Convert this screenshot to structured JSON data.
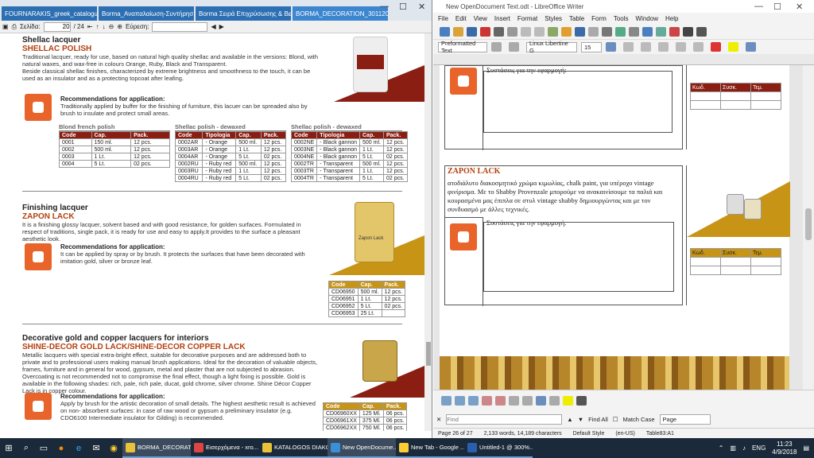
{
  "browser": {
    "tabs": [
      {
        "label": "FOURNARAKIS_greek_catalogue..."
      },
      {
        "label": "Borma_Αναπαλαίωση-Συντήρησ..."
      },
      {
        "label": "Borma Σειρά Επιχρύσωσης & Βε..."
      },
      {
        "label": "BORMA_DECORATION_3011201..."
      }
    ],
    "page_label": "Σελίδα:",
    "page_value": "20",
    "page_total": "/ 24",
    "search_label": "Εύρεση:"
  },
  "pdf": {
    "shellac": {
      "title": "Shellac lacquer",
      "subtitle": "SHELLAC POLISH",
      "desc1": "Traditional lacquer, ready for use, based on natural high quality shellac and available in the versions: Blond, with natural waxes, and wax-free in colours Orange, Ruby, Black and Transparent.",
      "desc2": "Beside classical shellac finishes, characterized by extreme brightness and smoothness to the touch, it can be used as an insulator and as a protecting topcoat after leafing.",
      "rec_title": "Recommendations for application:",
      "rec_text": "Traditionally applied by buffer for the finishing of furniture, this lacuer can be spreaded also by brush to insulate and protect small areas.",
      "t1": {
        "caption": "Blond french polish",
        "headers": [
          "Code",
          "Cap.",
          "Pack."
        ],
        "rows": [
          [
            "0001",
            "150 ml.",
            "12 pcs."
          ],
          [
            "0002",
            "500 ml.",
            "12 pcs."
          ],
          [
            "0003",
            "1 Lt.",
            "12 pcs."
          ],
          [
            "0004",
            "5 Lt.",
            "02 pcs."
          ]
        ]
      },
      "t2": {
        "caption": "Shellac polish - dewaxed",
        "headers": [
          "Code",
          "Tipologia",
          "Cap.",
          "Pack."
        ],
        "rows": [
          [
            "0002AR",
            "- Orange",
            "500 ml.",
            "12 pcs."
          ],
          [
            "0003AR",
            "- Orange",
            "1 Lt.",
            "12 pcs."
          ],
          [
            "0004AR",
            "- Orange",
            "5 Lt.",
            "02 pcs."
          ],
          [
            "0002RU",
            "- Ruby red",
            "500 ml.",
            "12 pcs."
          ],
          [
            "0003RU",
            "- Ruby red",
            "1 Lt.",
            "12 pcs."
          ],
          [
            "0004RU",
            "- Ruby red",
            "5 Lt.",
            "02 pcs."
          ]
        ]
      },
      "t3": {
        "caption": "Shellac polish - dewaxed",
        "headers": [
          "Code",
          "Tipologia",
          "Cap.",
          "Pack."
        ],
        "rows": [
          [
            "0002NE",
            "- Black gannon",
            "500 ml.",
            "12 pcs."
          ],
          [
            "0003NE",
            "- Black gannon",
            "1 Lt.",
            "12 pcs."
          ],
          [
            "0004NE",
            "- Black gannon",
            "5 Lt.",
            "02 pcs."
          ],
          [
            "0002TR",
            "- Transparent",
            "500 ml.",
            "12 pcs."
          ],
          [
            "0003TR",
            "- Transparent",
            "1 Lt.",
            "12 pcs."
          ],
          [
            "0004TR",
            "- Transparent",
            "5 Lt.",
            "02 pcs."
          ]
        ]
      }
    },
    "zapon": {
      "title": "Finishing lacquer",
      "subtitle": "ZAPON LACK",
      "desc": "It is  a finishing glossy lacquer, solvent based and with good resistance, for golden surfaces. Formulated in respect of traditions, single pack, it is ready for use and easy to apply.It provides to the surface a pleasant aesthetic look.",
      "rec_title": "Recommendations for application:",
      "rec_text": "It can be applied by spray or by brush. It protects the surfaces that have been decorated with imitation gold, silver or bronze leaf.",
      "can_label": "Zapon Lack",
      "table": {
        "headers": [
          "Code",
          "Cap.",
          "Pack."
        ],
        "rows": [
          [
            "CD06950",
            "500 ml.",
            "12 pcs."
          ],
          [
            "CD06951",
            "1 Lt.",
            "12 pcs."
          ],
          [
            "CD06952",
            "5 Lt.",
            "02 pcs."
          ],
          [
            "CD06953",
            "25 Lt.",
            ""
          ]
        ]
      }
    },
    "decor": {
      "title": "Decorative gold and copper lacquers for  interiors",
      "subtitle": "SHINE-DECOR GOLD LACK/SHINE-DECOR COPPER LACK",
      "desc": "Metallic lacquers with special extra-bright effect, suitable for decorative purposes and are addressed both to private and to professional users making manual brush applications. Ideal for the decoration of valuable objects, frames, furniture and in general for wood, gypsum, metal and plaster that are not subjected to abrasion. Overcoating is not recommended not to compromise the final effect, though a light fixing is possible. Gold is available in the following shades: rich, pale, rich pale, ducat, gold chrome, silver chrome. Shine Décor Copper Lack is in copper colour.",
      "rec_title": "Recommendations for application:",
      "rec_text": "Apply by brush for the artistic decoration of small details. The highest aesthetic result is achieved on non- absorbent surfaces: in case of raw wood or gypsum a preliminary insulator (e.g. CDO6100 Intermediate insulator for Gilding) is recommended.",
      "table": {
        "headers": [
          "Code",
          "Cap.",
          "Pack."
        ],
        "rows": [
          [
            "CD06960XX",
            "125 Ml.",
            "06 pcs."
          ],
          [
            "CD06961XX",
            "375 Ml.",
            "06 pcs."
          ],
          [
            "CD06962XX",
            "750 Ml.",
            "06 pcs."
          ]
        ]
      }
    }
  },
  "writer": {
    "title": "New OpenDocument Text.odt - LibreOffice Writer",
    "menu": [
      "File",
      "Edit",
      "View",
      "Insert",
      "Format",
      "Styles",
      "Table",
      "Form",
      "Tools",
      "Window",
      "Help"
    ],
    "para_style": "Preformatted Text",
    "font_name": "Linux Libertine G",
    "font_size": "15",
    "rec_label": "Συστάσεις για την εφαρμογή:",
    "zapon_head": "ZAPON LACK",
    "zapon_text": "ατοδιάλυτο διακοσμητικό χρώμα κιμωλίας, chalk paint, για υπέροχο vintage φινίρισμα. Με το Shabby Provenzale μπορούμε να ανακαινίσουμε τα παλιά και κουρασμένα μας έπιπλα σε στυλ vintage shabby δημιουργώντας και με τον συνδυασμό με άλλες τεχνικές.",
    "table_headers": [
      "Κωδ.",
      "Συσκ.",
      "Τεμ."
    ],
    "find_placeholder": "Find",
    "find_all": "Find All",
    "match_case": "Match Case",
    "find_target": "Page",
    "status": [
      "Page 26 of 27",
      "2,133 words, 14,189 characters",
      "Default Style",
      "(en-US)",
      "Table83:A1"
    ]
  },
  "taskbar": {
    "apps": [
      {
        "label": "BORMA_DECORATI..."
      },
      {
        "label": "Εισερχόμενα - xro..."
      },
      {
        "label": "KATALOGOS DIAKO..."
      },
      {
        "label": "New OpenDocume..."
      },
      {
        "label": "New Tab - Google ..."
      },
      {
        "label": "Untitled-1 @ 300%..."
      }
    ],
    "lang": "ENG",
    "time": "11:23",
    "date": "4/9/2018"
  }
}
